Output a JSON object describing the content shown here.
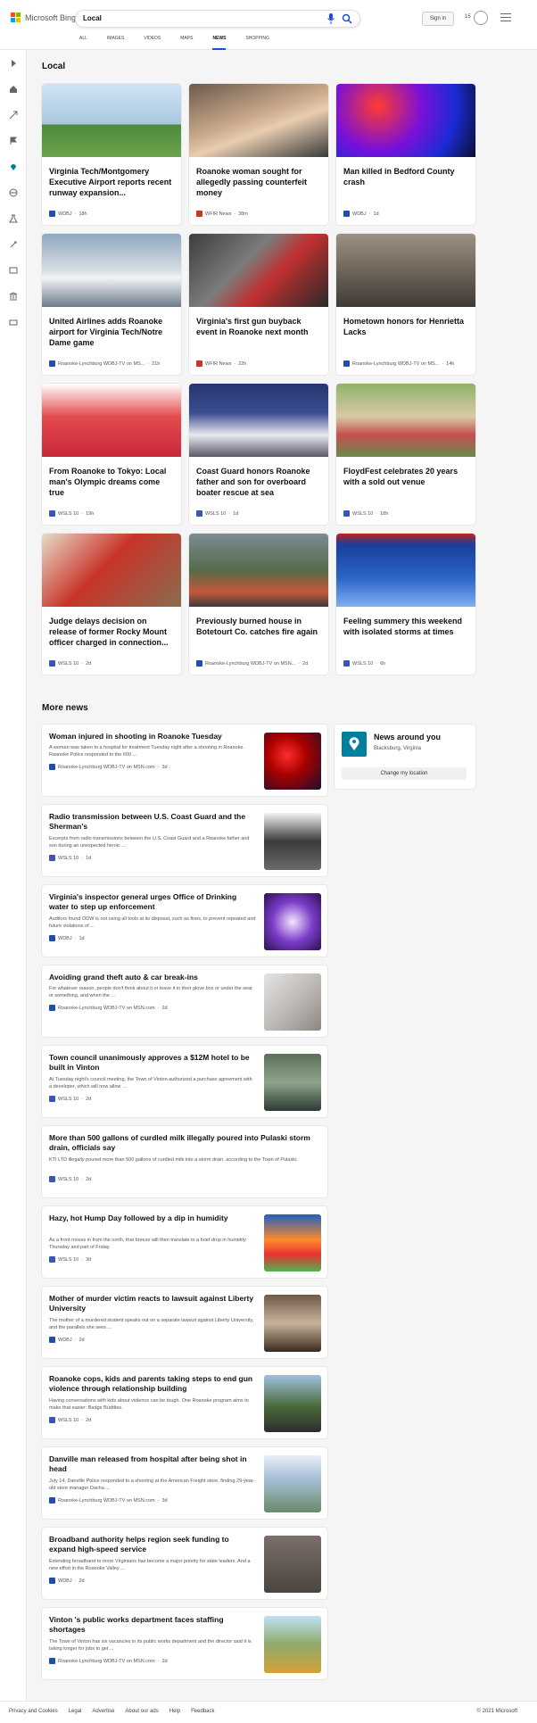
{
  "header": {
    "logo_text": "Microsoft Bing",
    "search_value": "Local",
    "signin_label": "Sign in",
    "points": "15"
  },
  "tabs": [
    "ALL",
    "IMAGES",
    "VIDEOS",
    "MAPS",
    "NEWS",
    "SHOPPING"
  ],
  "active_tab": "NEWS",
  "local": {
    "heading": "Local",
    "cards": [
      {
        "title": "Virginia Tech/Montgomery Executive Airport reports recent runway expansion...",
        "source": "WDBJ",
        "age": "18h",
        "icon": "wdbj"
      },
      {
        "title": "Roanoke woman sought for allegedly passing counterfeit money",
        "source": "WFIR News",
        "age": "38m",
        "icon": "wfir"
      },
      {
        "title": "Man killed in Bedford County crash",
        "source": "WDBJ",
        "age": "1d",
        "icon": "wdbj"
      },
      {
        "title": "United Airlines adds Roanoke airport for Virginia Tech/Notre Dame game",
        "source": "Roanoke-Lynchburg WDBJ-TV on MS...",
        "age": "21h",
        "icon": "wdbj"
      },
      {
        "title": "Virginia's first gun buyback event in Roanoke next month",
        "source": "WFIR News",
        "age": "22h",
        "icon": "wfir"
      },
      {
        "title": "Hometown honors for Henrietta Lacks",
        "source": "Roanoke-Lynchburg WDBJ-TV on MS...",
        "age": "14h",
        "icon": "wdbj"
      },
      {
        "title": "From Roanoke to Tokyo: Local man's Olympic dreams come true",
        "source": "WSLS 10",
        "age": "19h",
        "icon": "wsls"
      },
      {
        "title": "Coast Guard honors Roanoke father and son for overboard boater rescue at sea",
        "source": "WSLS 10",
        "age": "1d",
        "icon": "wsls"
      },
      {
        "title": "FloydFest celebrates 20 years with a sold out venue",
        "source": "WSLS 10",
        "age": "18h",
        "icon": "wsls"
      },
      {
        "title": "Judge delays decision on release of former Rocky Mount officer charged in connection...",
        "source": "WSLS 10",
        "age": "2d",
        "icon": "wsls"
      },
      {
        "title": "Previously burned house in Botetourt Co. catches fire again",
        "source": "Roanoke-Lynchburg WDBJ-TV on MSN...",
        "age": "2d",
        "icon": "wdbj"
      },
      {
        "title": "Feeling summery this weekend with isolated storms at times",
        "source": "WSLS 10",
        "age": "6h",
        "icon": "wsls"
      }
    ]
  },
  "more_news": {
    "heading": "More news",
    "items": [
      {
        "title": "Woman injured in shooting in Roanoke Tuesday",
        "desc": "A woman was taken to a hospital for treatment Tuesday night after a shooting in Roanoke. Roanoke Police responded to the 600 ...",
        "source": "Roanoke-Lynchburg WDBJ-TV on MSN.com",
        "age": "3d",
        "icon": "wdbj"
      },
      {
        "title": "Radio transmission between U.S. Coast Guard and the Sherman's",
        "desc": "Excerpts from radio transmissions between the U.S. Coast Guard and a Roanoke father and son during an unexpected heroic ...",
        "source": "WSLS 10",
        "age": "1d",
        "icon": "wsls"
      },
      {
        "title": "Virginia's inspector general urges Office of Drinking water to step up enforcement",
        "desc": "Auditors found ODW is not using all tools at its disposal, such as fines, to prevent repeated and future violations of ...",
        "source": "WDBJ",
        "age": "1d",
        "icon": "wdbj"
      },
      {
        "title": "Avoiding grand theft auto & car break-ins",
        "desc": "For whatever reason, people don't think about it or leave it in their glove box or under the seat or something, and when the ...",
        "source": "Roanoke-Lynchburg WDBJ-TV on MSN.com",
        "age": "2d",
        "icon": "wdbj"
      },
      {
        "title": "Town council unanimously approves a $12M hotel to be built in Vinton",
        "desc": "At Tuesday night's council meeting, the Town of Vinton authorized a purchase agreement with a developer, which will now allow ...",
        "source": "WSLS 10",
        "age": "2d",
        "icon": "wsls"
      },
      {
        "title": "More than 500 gallons of curdled milk illegally poured into Pulaski storm drain, officials say",
        "desc": "KTI LTD illegally poured more than 500 gallons of curdled milk into a storm drain, according to the Town of Pulaski.",
        "source": "WSLS 10",
        "age": "2d",
        "icon": "wsls"
      },
      {
        "title": "Hazy, hot Hump Day followed by a dip in humidity",
        "desc": "As a front moves in from the north, that breeze will then translate to a brief drop in humidity Thursday and part of Friday.",
        "source": "WSLS 10",
        "age": "3d",
        "icon": "wsls"
      },
      {
        "title": "Mother of murder victim reacts to lawsuit against Liberty University",
        "desc": "The mother of a murdered student speaks out on a separate lawsuit against Liberty University, and the parallels she sees ...",
        "source": "WDBJ",
        "age": "2d",
        "icon": "wdbj"
      },
      {
        "title": "Roanoke cops, kids and parents taking steps to end gun violence through relationship building",
        "desc": "Having conversations with kids about violence can be tough. One Roanoke program aims to make that easier: Badge Buddies.",
        "source": "WSLS 10",
        "age": "2d",
        "icon": "wsls"
      },
      {
        "title": "Danville man released from hospital after being shot in head",
        "desc": "July 14, Danville Police responded to a shooting at the American Freight store, finding 29-year-old store manager Dacha ...",
        "source": "Roanoke-Lynchburg WDBJ-TV on MSN.com",
        "age": "3d",
        "icon": "wdbj"
      },
      {
        "title": "Broadband authority helps region seek funding to expand high-speed service",
        "desc": "Extending broadband to more Virginians has become a major priority for state leaders. And a new effort in the Roanoke Valley ...",
        "source": "WDBJ",
        "age": "2d",
        "icon": "wdbj"
      },
      {
        "title": "Vinton 's public works department faces staffing shortages",
        "desc": "The Town of Vinton has six vacancies in its public works department and the director said it is taking longer for jobs to get ...",
        "source": "Roanoke-Lynchburg WDBJ-TV on MSN.com",
        "age": "2d",
        "icon": "wdbj"
      }
    ]
  },
  "location": {
    "title": "News around you",
    "place": "Blacksburg, Virginia",
    "button": "Change my location"
  },
  "footer": {
    "links": [
      "Privacy and Cookies",
      "Legal",
      "Advertise",
      "About our ads",
      "Help",
      "Feedback"
    ],
    "copyright": "© 2021 Microsoft"
  },
  "colors": {
    "accent": "#174ae4",
    "wdbj": "#1f4fa8",
    "wfir": "#c8352b",
    "wsls": "#3a55b4"
  }
}
